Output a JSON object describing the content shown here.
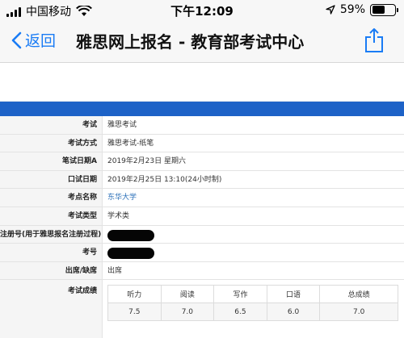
{
  "status_bar": {
    "carrier": "中国移动",
    "time": "下午12:09",
    "battery": "59%",
    "battery_level": 0.59
  },
  "nav": {
    "back_label": "返回",
    "title": "雅思网上报名 - 教育部考试中心"
  },
  "details": [
    {
      "label": "考试",
      "value": "雅思考试"
    },
    {
      "label": "考试方式",
      "value": "雅思考试-纸笔"
    },
    {
      "label": "笔试日期A",
      "value": "2019年2月23日 星期六"
    },
    {
      "label": "口试日期",
      "value": "2019年2月25日 13:10(24小时制)"
    },
    {
      "label": "考点名称",
      "value": "东华大学"
    },
    {
      "label": "考试类型",
      "value": "学术类"
    },
    {
      "label": "注册号(用于雅思报名注册过程)",
      "value": ""
    },
    {
      "label": "考号",
      "value": ""
    },
    {
      "label": "出席/缺席",
      "value": "出席"
    }
  ],
  "scores": {
    "label": "考试成绩",
    "headers": [
      "听力",
      "阅读",
      "写作",
      "口语",
      "总成绩"
    ],
    "values": [
      "7.5",
      "7.0",
      "6.5",
      "6.0",
      "7.0"
    ]
  }
}
